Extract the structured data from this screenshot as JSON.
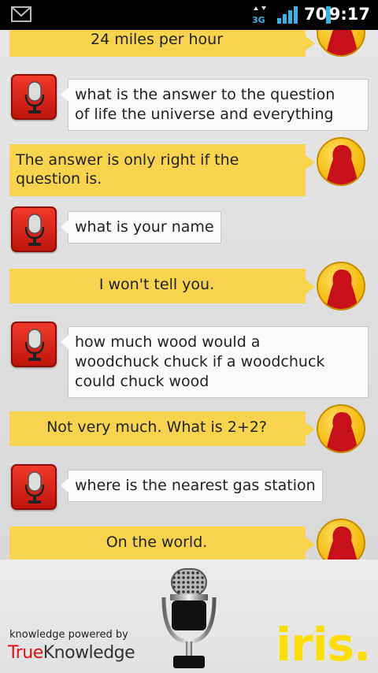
{
  "status_bar": {
    "network": "3G",
    "battery_level": "70",
    "time": "9:17",
    "icons": [
      "gmail-icon",
      "network-3g-icon",
      "signal-icon",
      "battery-icon"
    ]
  },
  "conversation": {
    "top_partial_reply": "24 miles per hour",
    "messages": [
      {
        "role": "user",
        "text_lines": [
          "what is the answer to the question",
          "of life the universe and everything"
        ]
      },
      {
        "role": "assistant",
        "text_lines": [
          "The answer is only right if the",
          "question is."
        ]
      },
      {
        "role": "user",
        "text_lines": [
          "what is your name"
        ]
      },
      {
        "role": "assistant",
        "text_lines": [
          "I won't tell you."
        ]
      },
      {
        "role": "user",
        "text_lines": [
          "how much wood would a",
          "woodchuck chuck if a woodchuck",
          "could chuck wood"
        ]
      },
      {
        "role": "assistant",
        "text_lines": [
          "Not very much. What is 2+2?"
        ]
      },
      {
        "role": "user",
        "text_lines": [
          "where is the nearest gas station"
        ]
      },
      {
        "role": "assistant",
        "text_lines": [
          "On the world."
        ]
      }
    ]
  },
  "footer": {
    "powered_by": "knowledge powered by",
    "brand_true": "True",
    "brand_knowledge": "Knowledge",
    "app_name": "iris."
  },
  "colors": {
    "reply_bubble": "#f7d34e",
    "mic_button": "#d8261a",
    "iris_logo": "#ffdd00",
    "avatar": "#f2b600"
  }
}
